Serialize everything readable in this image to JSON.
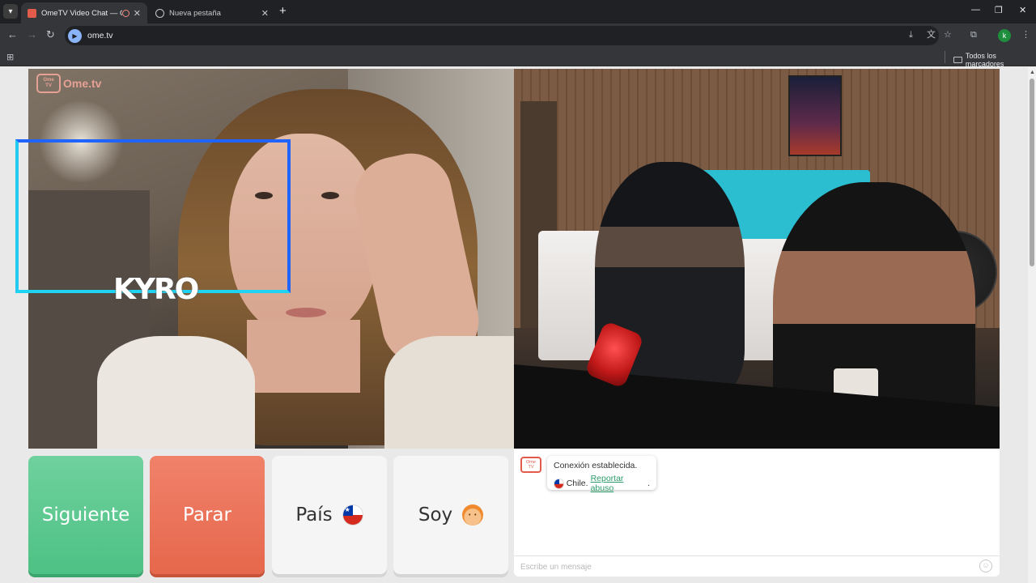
{
  "browser": {
    "tabs": [
      {
        "title": "OmeTV Video Chat — Ome",
        "active": true
      },
      {
        "title": "Nueva pestaña",
        "active": false
      }
    ],
    "url": "ome.tv",
    "bookmarks_all": "Todos los marcadores",
    "profile_initial": "k",
    "icons": {
      "back": "←",
      "forward": "→",
      "reload": "↻",
      "minimize": "—",
      "restore": "❐",
      "close": "✕",
      "new_tab": "+",
      "tab_close": "✕",
      "apps": "⊞",
      "menu": "⋮"
    }
  },
  "stranger_video": {
    "watermark": "Ome.tv",
    "logo_top": "Ome",
    "logo_bottom": "TV",
    "overlay_text": "KYRO"
  },
  "controls": {
    "next_label": "Siguiente",
    "stop_label": "Parar",
    "country_label": "País",
    "gender_label": "Soy"
  },
  "chat": {
    "logo_top": "Ome",
    "logo_bottom": "TV",
    "message_line1": "Conexión establecida.",
    "country_text": "Chile.",
    "report_link": "Reportar abuso",
    "report_suffix": ".",
    "input_placeholder": "Escribe un mensaje"
  },
  "colors": {
    "next_button": "#4ec184",
    "stop_button": "#e6674c",
    "overlay_frame": "#1f64ff",
    "report_link": "#2c9b6a"
  }
}
